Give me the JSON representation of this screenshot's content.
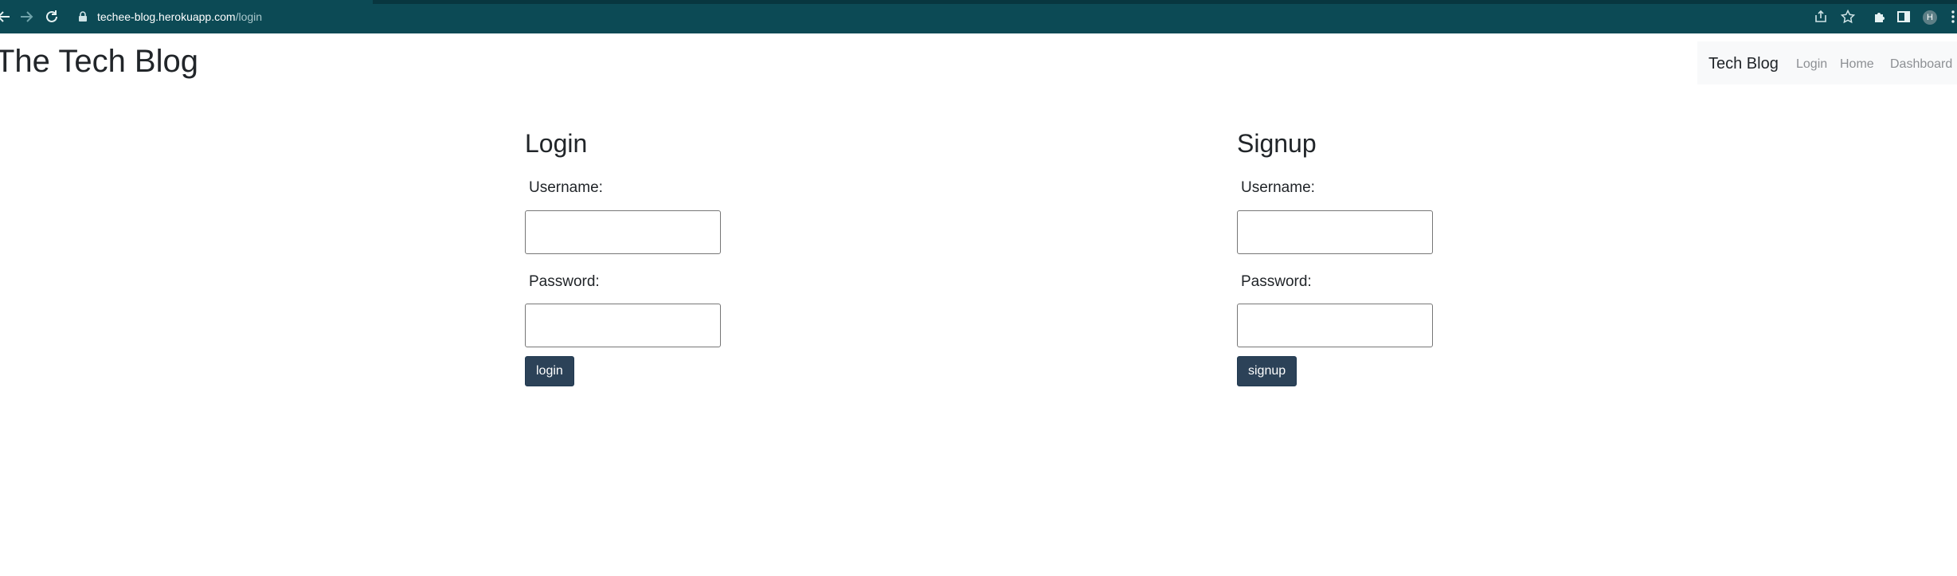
{
  "browser": {
    "url_host": "techee-blog.herokuapp.com",
    "url_path": "/login",
    "profile_initial": "H",
    "icons": {
      "back": "back-arrow-icon",
      "forward": "forward-arrow-icon",
      "reload": "reload-icon",
      "lock": "lock-icon",
      "share": "share-icon",
      "bookmark": "star-icon",
      "extensions": "puzzle-icon",
      "side_panel": "side-panel-icon",
      "menu": "kebab-menu-icon"
    }
  },
  "header": {
    "site_title": "The Tech Blog"
  },
  "navbar": {
    "brand": "Tech Blog",
    "links": [
      "Login",
      "Home",
      "Dashboard"
    ]
  },
  "login_form": {
    "heading": "Login",
    "username_label": "Username:",
    "username_value": "",
    "password_label": "Password:",
    "password_value": "",
    "submit_label": "login"
  },
  "signup_form": {
    "heading": "Signup",
    "username_label": "Username:",
    "username_value": "",
    "password_label": "Password:",
    "password_value": "",
    "submit_label": "signup"
  },
  "colors": {
    "chrome_background": "#0c4a55",
    "button_background": "#2c4258",
    "navbar_background": "#f8f9fa",
    "nav_link": "#8c8f93"
  }
}
